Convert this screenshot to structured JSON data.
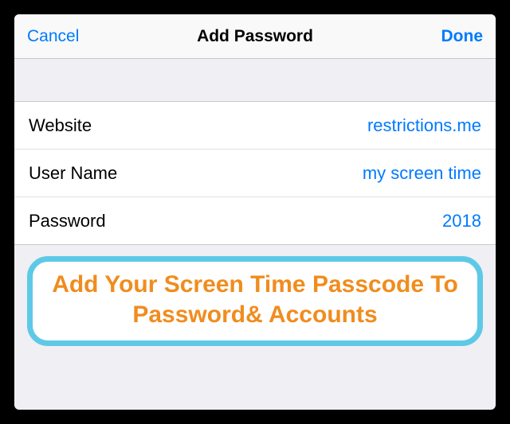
{
  "nav": {
    "cancel": "Cancel",
    "title": "Add Password",
    "done": "Done"
  },
  "fields": {
    "website": {
      "label": "Website",
      "value": "restrictions.me"
    },
    "username": {
      "label": "User Name",
      "value": "my screen time"
    },
    "password": {
      "label": "Password",
      "value": "2018"
    }
  },
  "callout": {
    "text": "Add Your Screen Time Passcode To Password& Accounts"
  },
  "colors": {
    "accent": "#007aff",
    "callout_border": "#5ec9e7",
    "callout_text": "#f08c1e"
  }
}
